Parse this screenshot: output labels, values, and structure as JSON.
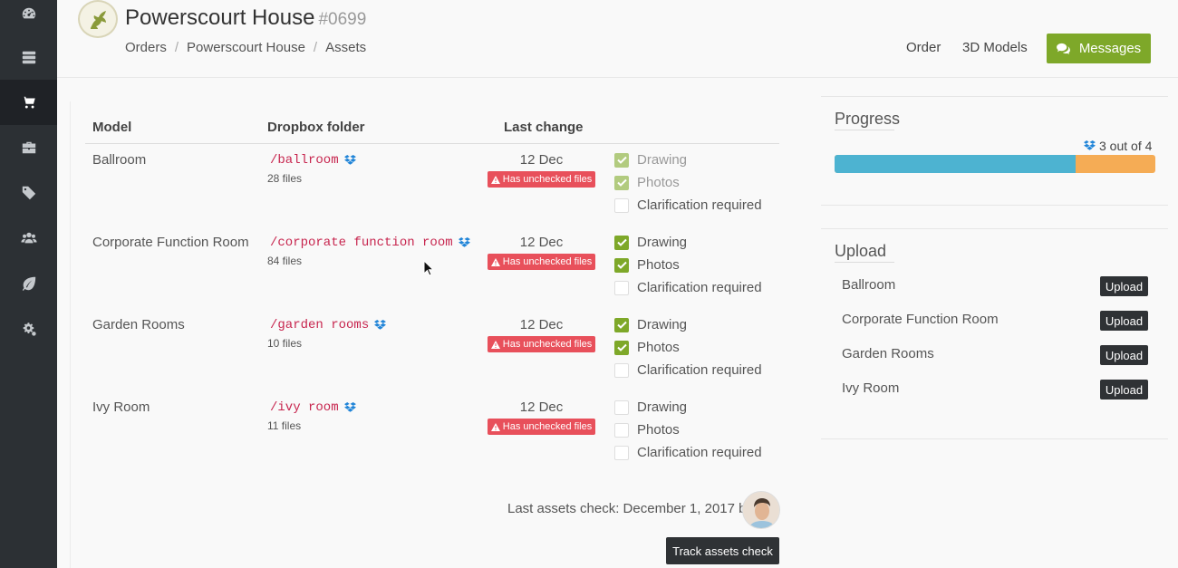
{
  "sidebar": {
    "items": [
      {
        "icon": "dashboard-icon",
        "active": false
      },
      {
        "icon": "server-icon",
        "active": false
      },
      {
        "icon": "cart-icon",
        "active": true
      },
      {
        "icon": "briefcase-icon",
        "active": false
      },
      {
        "icon": "tags-icon",
        "active": false
      },
      {
        "icon": "users-icon",
        "active": false
      },
      {
        "icon": "leaf-icon",
        "active": false
      },
      {
        "icon": "gears-icon",
        "active": false
      }
    ]
  },
  "header": {
    "title": "Powerscourt House",
    "order_number": "#0699",
    "breadcrumb": [
      "Orders",
      "Powerscourt House",
      "Assets"
    ],
    "nav": {
      "order": "Order",
      "models": "3D Models",
      "messages": "Messages"
    }
  },
  "table": {
    "headers": {
      "model": "Model",
      "folder": "Dropbox folder",
      "last_change": "Last change"
    },
    "rows": [
      {
        "model": "Ballroom",
        "folder": "/ballroom",
        "files": "28 files",
        "date": "12 Dec",
        "warning": "Has unchecked files",
        "checks": [
          {
            "label": "Drawing",
            "checked": true
          },
          {
            "label": "Photos",
            "checked": true
          },
          {
            "label": "Clarification required",
            "checked": false
          }
        ]
      },
      {
        "model": "Corporate Function Room",
        "folder": "/corporate function room",
        "files": "84 files",
        "date": "12 Dec",
        "warning": "Has unchecked files",
        "checks": [
          {
            "label": "Drawing",
            "checked": true
          },
          {
            "label": "Photos",
            "checked": true
          },
          {
            "label": "Clarification required",
            "checked": false
          }
        ]
      },
      {
        "model": "Garden Rooms",
        "folder": "/garden rooms",
        "files": "10 files",
        "date": "12 Dec",
        "warning": "Has unchecked files",
        "checks": [
          {
            "label": "Drawing",
            "checked": true
          },
          {
            "label": "Photos",
            "checked": true
          },
          {
            "label": "Clarification required",
            "checked": false
          }
        ]
      },
      {
        "model": "Ivy Room",
        "folder": "/ivy room",
        "files": "11 files",
        "date": "12 Dec",
        "warning": "Has unchecked files",
        "checks": [
          {
            "label": "Drawing",
            "checked": false
          },
          {
            "label": "Photos",
            "checked": false
          },
          {
            "label": "Clarification required",
            "checked": false
          }
        ]
      }
    ],
    "last_check": "Last assets check: December 1, 2017 by",
    "track_button": "Track assets check"
  },
  "progress": {
    "title": "Progress",
    "label": "3 out of 4",
    "fraction": 0.75
  },
  "upload": {
    "title": "Upload",
    "items": [
      {
        "name": "Ballroom",
        "button": "Upload"
      },
      {
        "name": "Corporate Function Room",
        "button": "Upload"
      },
      {
        "name": "Garden Rooms",
        "button": "Upload"
      },
      {
        "name": "Ivy Room",
        "button": "Upload"
      }
    ]
  },
  "colors": {
    "accent_green": "#7ea829",
    "warning_red": "#e8505b",
    "progress_blue": "#4db3d1",
    "progress_orange": "#f5ac55",
    "sidebar_bg": "#2c3034"
  }
}
